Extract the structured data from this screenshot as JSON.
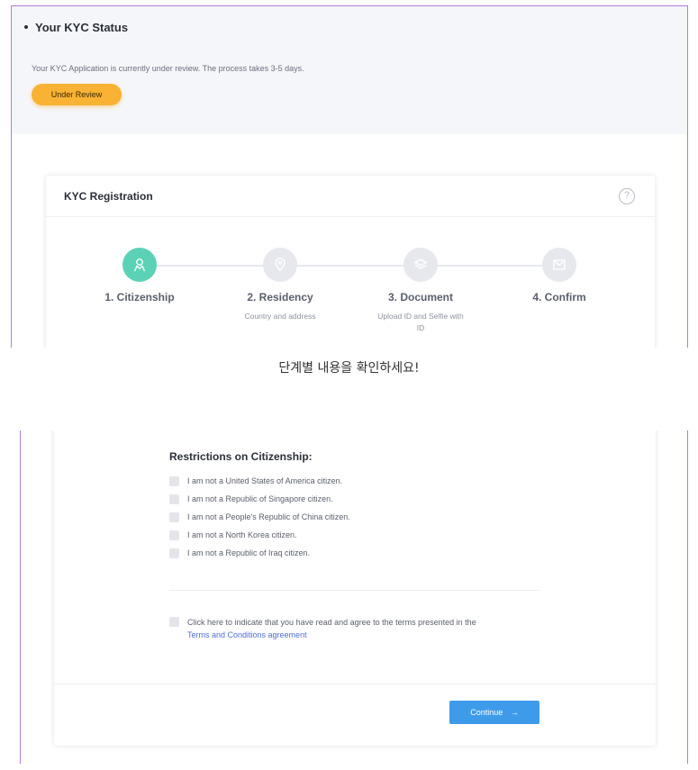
{
  "status": {
    "title": "Your KYC Status",
    "description": "Your KYC Application is currently under review. The process takes 3-5 days.",
    "badge_label": "Under Review",
    "badge_color": "#f9b233"
  },
  "kyc": {
    "title": "KYC Registration",
    "help_icon": "?",
    "steps": [
      {
        "label": "1. Citizenship",
        "sub": "",
        "icon": "user-icon",
        "active": true
      },
      {
        "label": "2. Residency",
        "sub": "Country and address",
        "icon": "location-icon",
        "active": false
      },
      {
        "label": "3. Document",
        "sub": "Upload ID and Selfie with ID",
        "icon": "layers-icon",
        "active": false
      },
      {
        "label": "4. Confirm",
        "sub": "",
        "icon": "mail-icon",
        "active": false
      }
    ],
    "active_color": "#5bd2b5"
  },
  "caption": "단계별 내용을 확인하세요!",
  "form": {
    "restrictions_title": "Restrictions on Citizenship:",
    "restrictions": [
      "I am not a United States of America citizen.",
      "I am not a Republic of Singapore citizen.",
      "I am not a People's Republic of China citizen.",
      "I am not a North Korea citizen.",
      "I am not a Republic of Iraq citizen."
    ],
    "terms_text": "Click here to indicate that you have read and agree to the terms presented in the",
    "terms_link": "Terms and Conditions agreement",
    "continue_label": "Continue",
    "continue_arrow": "→",
    "link_color": "#4f6fd1",
    "button_color": "#3e9bea"
  }
}
